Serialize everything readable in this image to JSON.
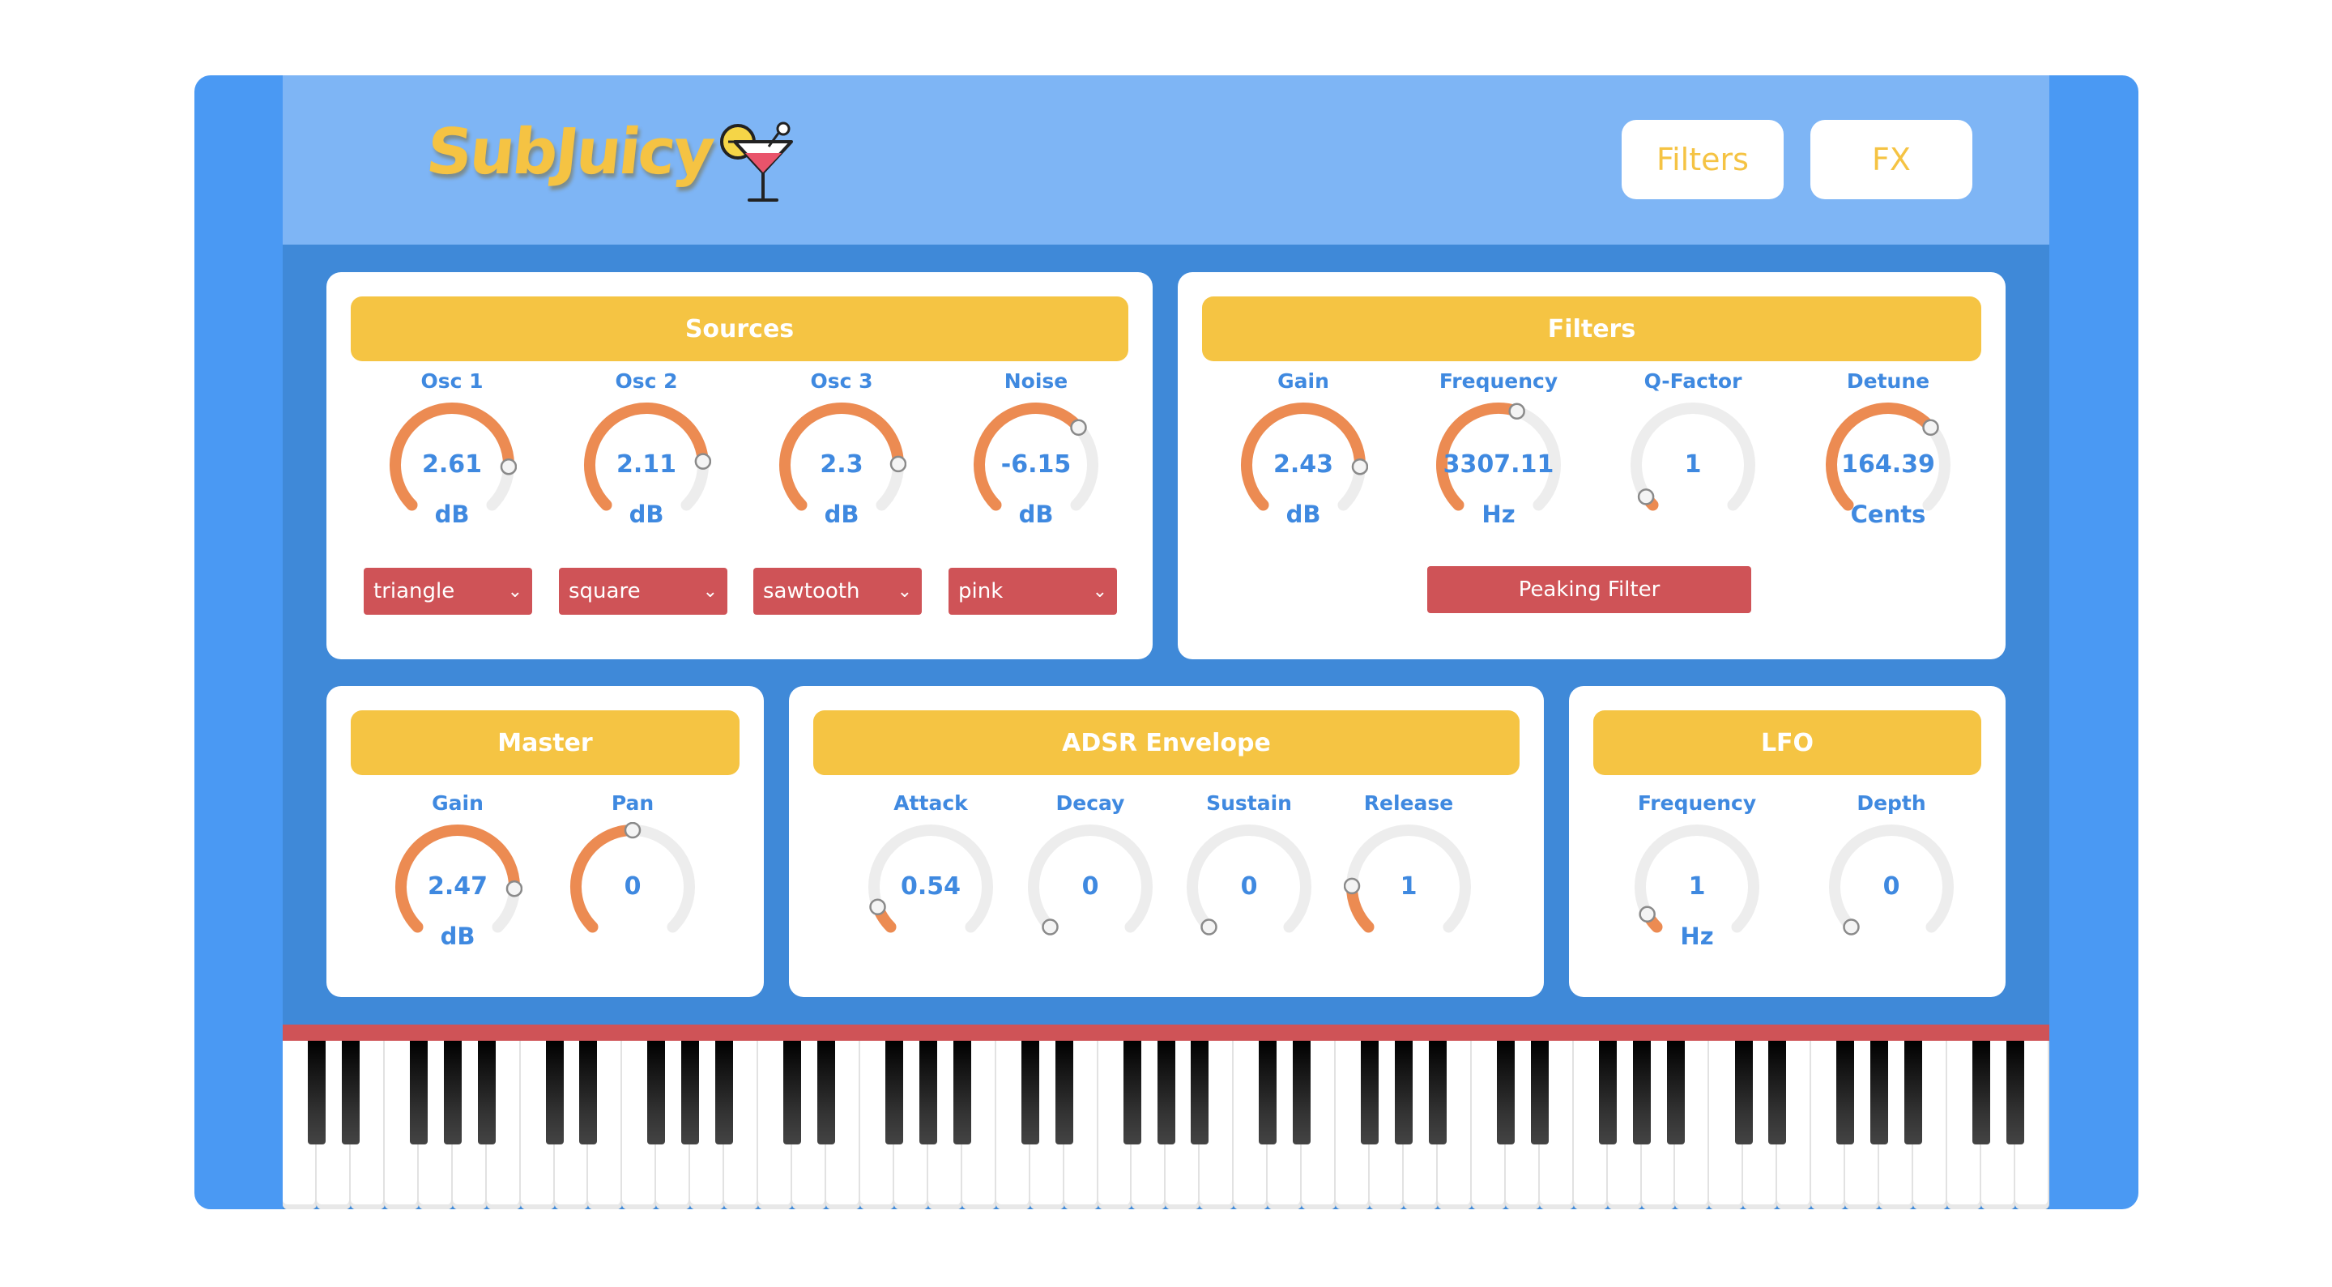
{
  "app": {
    "title": "SubJuicy",
    "logo_icon": "cocktail-icon"
  },
  "nav": {
    "filters_label": "Filters",
    "fx_label": "FX"
  },
  "colors": {
    "frame": "#4a99f3",
    "inner": "#3f89d8",
    "topbar": "#7eb5f5",
    "accent_yellow": "#f5c443",
    "knob_orange": "#ec8b52",
    "knob_track": "#ededed",
    "select_red": "#cf5357",
    "label_blue": "#3f89e0"
  },
  "sources": {
    "title": "Sources",
    "knobs": [
      {
        "label": "Osc 1",
        "value": "2.61",
        "unit": "dB",
        "level": 0.84
      },
      {
        "label": "Osc 2",
        "value": "2.11",
        "unit": "dB",
        "level": 0.82
      },
      {
        "label": "Osc 3",
        "value": "2.3",
        "unit": "dB",
        "level": 0.83
      },
      {
        "label": "Noise",
        "value": "-6.15",
        "unit": "dB",
        "level": 0.68
      }
    ],
    "selects": [
      "triangle",
      "square",
      "sawtooth",
      "pink"
    ]
  },
  "filters": {
    "title": "Filters",
    "knobs": [
      {
        "label": "Gain",
        "value": "2.43",
        "unit": "dB",
        "level": 0.84
      },
      {
        "label": "Frequency",
        "value": "3307.11",
        "unit": "Hz",
        "level": 0.57
      },
      {
        "label": "Q-Factor",
        "value": "1",
        "unit": "",
        "level": 0.04
      },
      {
        "label": "Detune",
        "value": "164.39",
        "unit": "Cents",
        "level": 0.68
      }
    ],
    "filter_type": "Peaking Filter"
  },
  "master": {
    "title": "Master",
    "knobs": [
      {
        "label": "Gain",
        "value": "2.47",
        "unit": "dB",
        "level": 0.84
      },
      {
        "label": "Pan",
        "value": "0",
        "unit": "",
        "level": 0.5
      }
    ]
  },
  "adsr": {
    "title": "ADSR Envelope",
    "knobs": [
      {
        "label": "Attack",
        "value": "0.54",
        "unit": "",
        "level": 0.09
      },
      {
        "label": "Decay",
        "value": "0",
        "unit": "",
        "level": 0.0
      },
      {
        "label": "Sustain",
        "value": "0",
        "unit": "",
        "level": 0.0
      },
      {
        "label": "Release",
        "value": "1",
        "unit": "",
        "level": 0.17
      }
    ]
  },
  "lfo": {
    "title": "LFO",
    "knobs": [
      {
        "label": "Frequency",
        "value": "1",
        "unit": "Hz",
        "level": 0.06
      },
      {
        "label": "Depth",
        "value": "0",
        "unit": "",
        "level": 0.0
      }
    ]
  },
  "keyboard": {
    "white_keys": 52
  }
}
